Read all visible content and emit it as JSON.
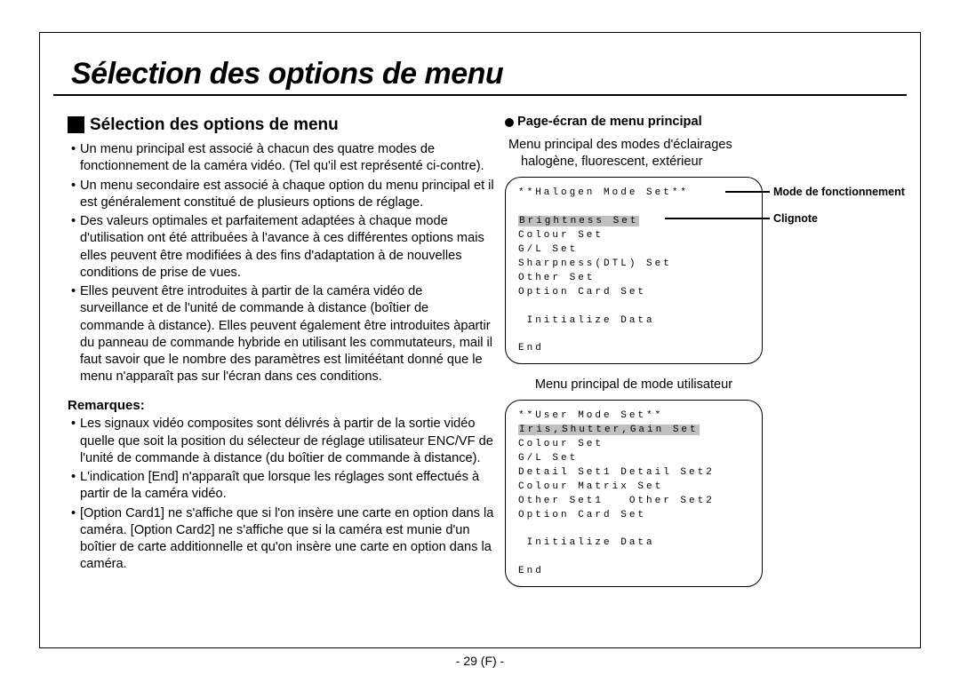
{
  "title": "Sélection des options de menu",
  "left": {
    "heading": "Sélection des options de menu",
    "bullets1": [
      "Un menu principal est associé à chacun des quatre modes de fonctionnement de la caméra vidéo. (Tel qu'il est représenté ci-contre).",
      "Un menu secondaire est associé à chaque option du menu principal et il est généralement constitué de plusieurs options de réglage.",
      "Des valeurs optimales et parfaitement adaptées à chaque mode d'utilisation ont été attribuées à l'avance à ces différentes options mais elles peuvent être modifiées à des fins d'adaptation à de nouvelles conditions de prise de vues.",
      "Elles peuvent être introduites à partir de la caméra vidéo de surveillance et de l'unité de commande à distance (boîtier de commande à distance). Elles peuvent également être introduites àpartir du panneau de commande hybride en utilisant les commutateurs, mail il faut savoir que le nombre des paramètres est limitéétant donné que le menu n'apparaît pas sur l'écran dans ces conditions."
    ],
    "remarques_label": "Remarques:",
    "bullets2": [
      "Les signaux vidéo composites sont délivrés à partir de la sortie vidéo quelle que soit la position du sélecteur de réglage utilisateur ENC/VF de l'unité de commande à distance (du boîtier de commande à distance).",
      "L'indication [End] n'apparaît que lorsque les réglages sont effectués à partir de la caméra vidéo.",
      "[Option Card1] ne s'affiche que si l'on insère une carte en option dans la caméra. [Option Card2] ne s'affiche que si la caméra est munie d'un boîtier de carte additionnelle et qu'on insère une carte en option dans la caméra."
    ]
  },
  "right": {
    "subheading": "Page-écran de menu principal",
    "intro_line1": "Menu principal des modes d'éclairages",
    "intro_line2": "halogène, fluorescent, extérieur",
    "annot_mode": "Mode de fonctionnement",
    "annot_clignote": "Clignote",
    "box1": {
      "title": "**Halogen Mode Set**",
      "highlight": "Brightness Set",
      "lines": [
        "Colour Set",
        "G/L Set",
        "Sharpness(DTL) Set",
        "Other Set",
        "Option Card Set"
      ],
      "spacer": " ",
      "init": " Initialize Data",
      "end": "End"
    },
    "user_caption": "Menu principal de mode utilisateur",
    "box2": {
      "title": "**User Mode Set**",
      "highlight": "Iris,Shutter,Gain Set",
      "lines": [
        "Colour Set",
        "G/L Set",
        "Detail Set1 Detail Set2",
        "Colour Matrix Set",
        "Other Set1   Other Set2",
        "Option Card Set"
      ],
      "spacer": " ",
      "init": " Initialize Data",
      "end": "End"
    }
  },
  "page_number": "- 29 (F) -"
}
